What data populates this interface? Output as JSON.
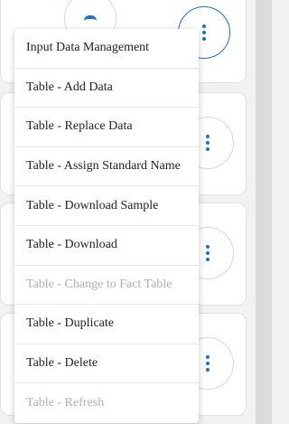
{
  "menu": {
    "items": [
      {
        "label": "Input Data Management",
        "disabled": false
      },
      {
        "label": "Table - Add Data",
        "disabled": false
      },
      {
        "label": "Table - Replace Data",
        "disabled": false
      },
      {
        "label": "Table - Assign Standard Name",
        "disabled": false
      },
      {
        "label": "Table - Download Sample",
        "disabled": false
      },
      {
        "label": "Table - Download",
        "disabled": false
      },
      {
        "label": "Table - Change to Fact Table",
        "disabled": true
      },
      {
        "label": "Table - Duplicate",
        "disabled": false
      },
      {
        "label": "Table - Delete",
        "disabled": false
      },
      {
        "label": "Table - Refresh",
        "disabled": true
      }
    ]
  },
  "icons": {
    "more_options": "vertical-ellipsis-icon"
  },
  "colors": {
    "accent": "#1d6fc7",
    "disabled_text": "#b0b0b0",
    "background": "#f2f2f2"
  }
}
